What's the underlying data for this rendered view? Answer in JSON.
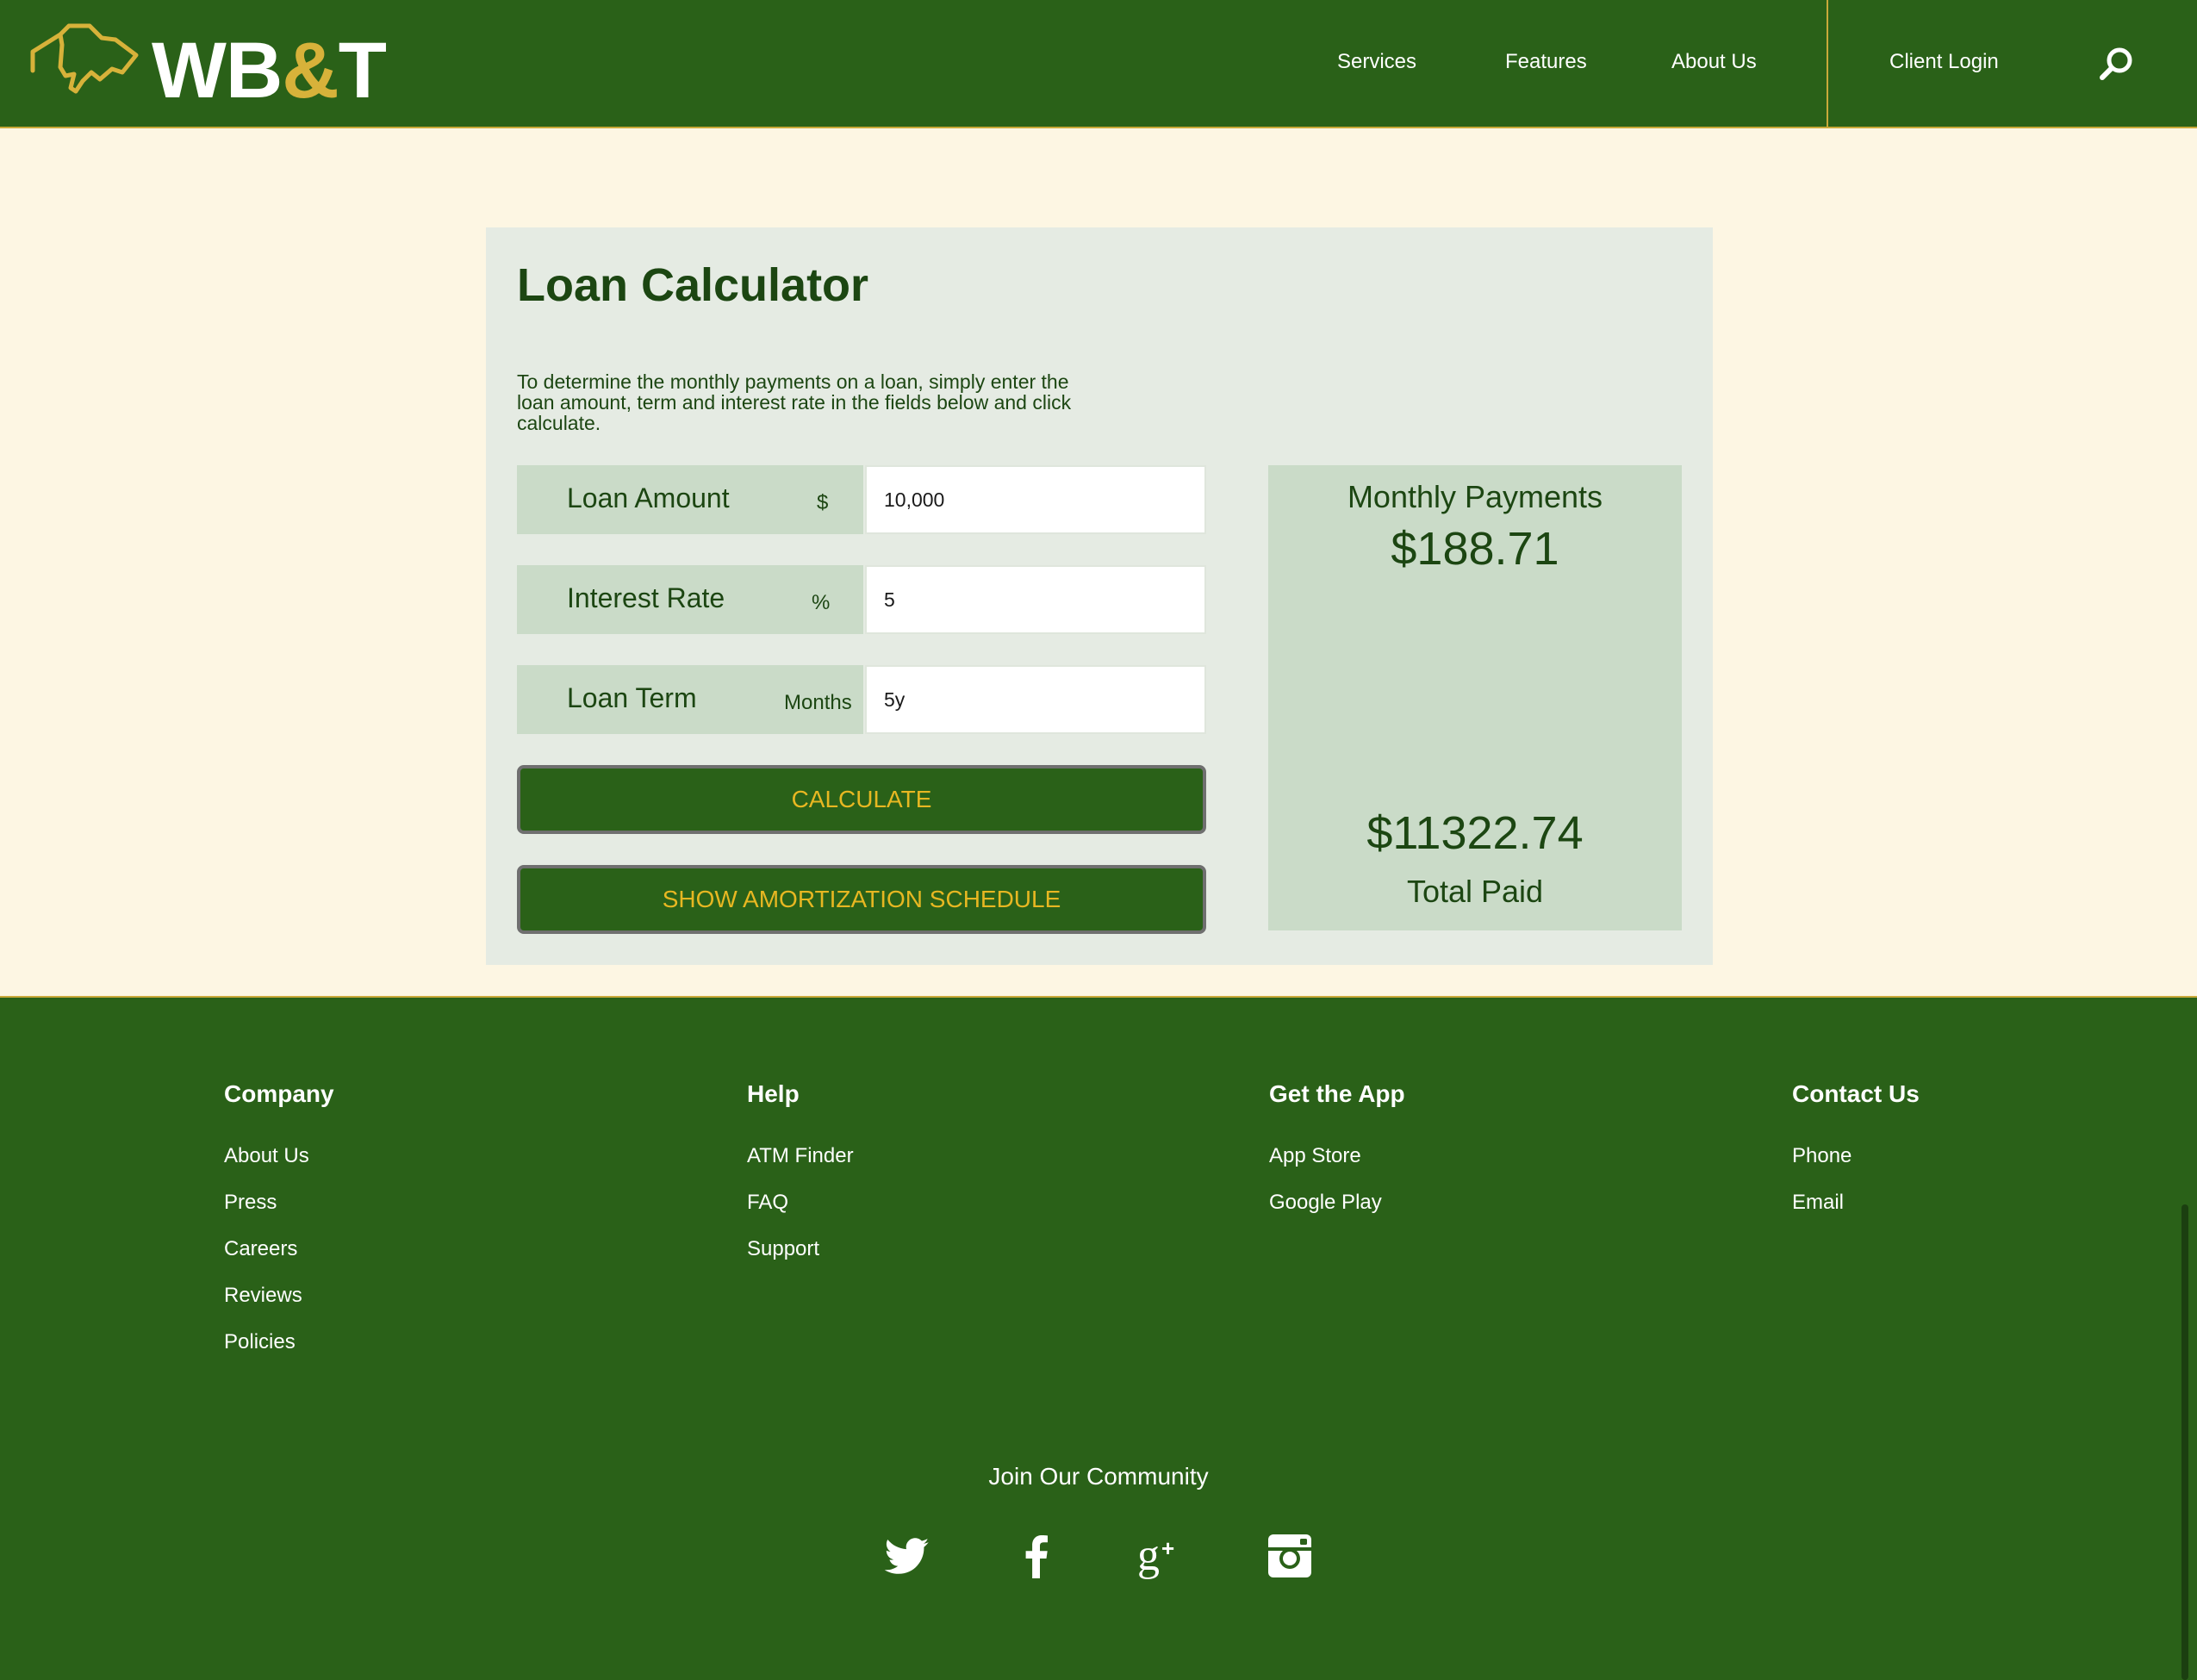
{
  "brand": {
    "name_left": "WB",
    "name_amp": "&",
    "name_right": "T"
  },
  "nav": {
    "services": "Services",
    "features": "Features",
    "about": "About Us",
    "login": "Client Login"
  },
  "calculator": {
    "title": "Loan Calculator",
    "description": "To determine the monthly payments on a loan, simply enter the loan amount, term and interest rate in the fields below and click calculate.",
    "fields": [
      {
        "label": "Loan Amount",
        "unit": "$",
        "value": "10,000"
      },
      {
        "label": "Interest Rate",
        "unit": "%",
        "value": "5"
      },
      {
        "label": "Loan Term",
        "unit": "Months",
        "value": "5y"
      }
    ],
    "calculate_label": "CALCULATE",
    "schedule_label": "SHOW AMORTIZATION SCHEDULE",
    "results": {
      "monthly_label": "Monthly Payments",
      "monthly_value": "$188.71",
      "total_value": "$11322.74",
      "total_label": "Total Paid"
    }
  },
  "footer": {
    "columns": [
      {
        "heading": "Company",
        "links": [
          "About Us",
          "Press",
          "Careers",
          "Reviews",
          "Policies"
        ]
      },
      {
        "heading": "Help",
        "links": [
          "ATM Finder",
          "FAQ",
          "Support"
        ]
      },
      {
        "heading": "Get the App",
        "links": [
          "App Store",
          "Google Play"
        ]
      },
      {
        "heading": "Contact Us",
        "links": [
          "Phone",
          "Email"
        ]
      }
    ],
    "community": "Join Our Community",
    "social_icons": [
      "twitter-icon",
      "facebook-icon",
      "google-plus-icon",
      "instagram-icon"
    ]
  },
  "colors": {
    "brand_green": "#2a6118",
    "accent_gold": "#d7b23a",
    "panel": "#e5ebe3",
    "label_bg": "#cadbc8",
    "page_bg": "#fdf6e3"
  }
}
